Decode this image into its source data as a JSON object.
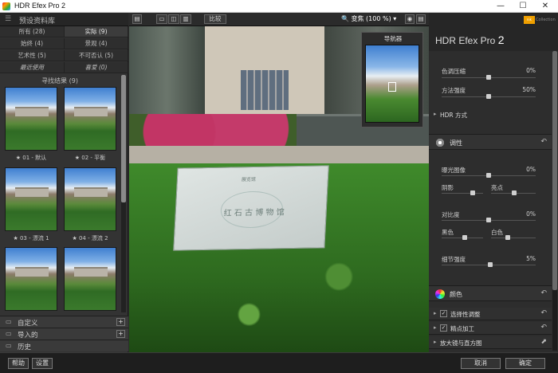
{
  "window": {
    "title": "HDR Efex Pro 2",
    "minimize": "—",
    "maximize": "☐",
    "close": "✕"
  },
  "left": {
    "header": "预设资料库",
    "filters": [
      {
        "label": "所有 (28)",
        "active": false
      },
      {
        "label": "实际 (9)",
        "active": true
      },
      {
        "label": "始终 (4)",
        "active": false
      },
      {
        "label": "景观 (4)",
        "active": false
      },
      {
        "label": "艺术性 (5)",
        "active": false
      },
      {
        "label": "不可否认 (5)",
        "active": false
      },
      {
        "label": "最近使用",
        "active": false
      },
      {
        "label": "喜爱 (0)",
        "active": false
      }
    ],
    "results": "寻找结果 (9)",
    "thumbs": [
      {
        "caption": "★ 01 - 默认"
      },
      {
        "caption": "★ 02 - 平衡"
      },
      {
        "caption": "★ 03 - 漂流 1"
      },
      {
        "caption": "★ 04 - 漂流 2"
      },
      {
        "caption": ""
      },
      {
        "caption": ""
      }
    ],
    "sections": [
      {
        "label": "自定义",
        "plus": "+"
      },
      {
        "label": "导入的",
        "plus": "+"
      },
      {
        "label": "历史",
        "plus": ""
      }
    ]
  },
  "toolbar": {
    "compare": "比较",
    "zoom": "变焦 (100 %)",
    "zoom_arrow": "▾"
  },
  "canvas": {
    "sign_line1": "展览馆",
    "sign_line2": "红 石 古 博 物 馆"
  },
  "navigator": {
    "title": "导航器"
  },
  "right": {
    "brand": "HDR Efex Pro",
    "brand_version": "2",
    "logo": "nik",
    "collection": "Collection",
    "tone_compression_label": "色调压缩",
    "tone_compression_value": "0%",
    "method_strength_label": "方法强度",
    "method_strength_value": "50%",
    "hdr_method": "HDR 方式",
    "tone_section": "调性",
    "exposure_label": "曝光图像",
    "exposure_value": "0%",
    "shadows_label": "阴影",
    "highlights_label": "亮点",
    "contrast_label": "对比度",
    "contrast_value": "0%",
    "blacks_label": "黑色",
    "whites_label": "白色",
    "detail_label": "细节强度",
    "detail_value": "5%",
    "color_section": "颜色",
    "rows": [
      {
        "label": "选择性调整",
        "checked": "✓"
      },
      {
        "label": "精点加工",
        "checked": "✓"
      },
      {
        "label": "放大镜与直方图",
        "checked": ""
      }
    ],
    "revert_icon": "↶"
  },
  "bottom": {
    "help": "帮助",
    "settings": "设置",
    "cancel": "取消",
    "ok": "确定"
  }
}
